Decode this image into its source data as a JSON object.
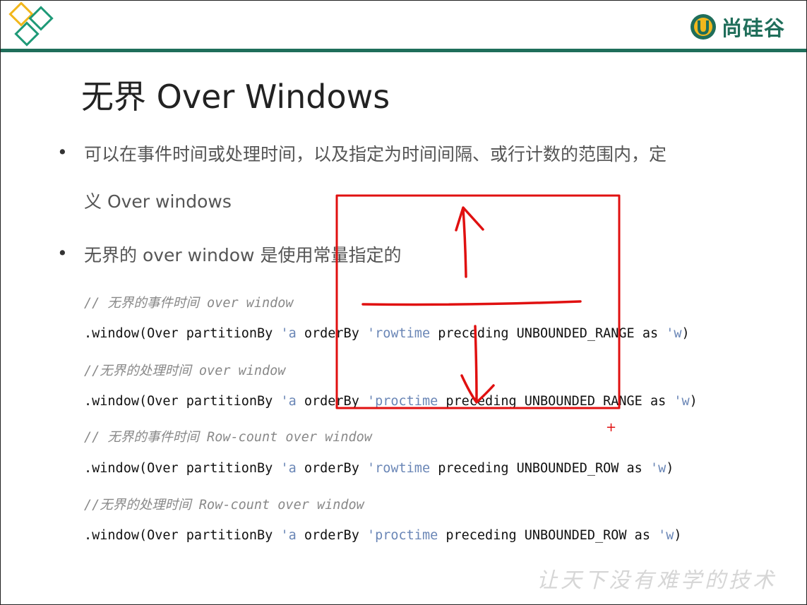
{
  "header": {
    "brand_name": "尚硅谷",
    "brand_letter": "U",
    "accent_color": "#1f6e5a",
    "corner_logo_colors": [
      "#f2b71c",
      "#1f9a78"
    ]
  },
  "title": "无界 Over Windows",
  "bullets": [
    {
      "line1": "可以在事件时间或处理时间，以及指定为时间间隔、或行计数的范围内，定",
      "line2": "义 Over windows"
    },
    {
      "line1": "无界的 over window 是使用常量指定的"
    }
  ],
  "code": [
    {
      "comment": "// 无界的事件时间 over window"
    },
    {
      "head": ".window(Over partitionBy ",
      "sym1": "'a",
      "mid1": " orderBy ",
      "sym2": "'rowtime",
      "mid2": " preceding UNBOUNDED_RANGE as ",
      "sym3": "'w",
      "tail": ")"
    },
    {
      "comment": "//无界的处理时间 over window"
    },
    {
      "head": ".window(Over partitionBy ",
      "sym1": "'a",
      "mid1": " orderBy ",
      "sym2": "'proctime",
      "mid2": " preceding UNBOUNDED_RANGE as ",
      "sym3": "'w",
      "tail": ")"
    },
    {
      "comment": "// 无界的事件时间 Row-count over window"
    },
    {
      "head": ".window(Over partitionBy ",
      "sym1": "'a",
      "mid1": " orderBy ",
      "sym2": "'rowtime",
      "mid2": " preceding UNBOUNDED_ROW as ",
      "sym3": "'w",
      "tail": ")"
    },
    {
      "comment": "//无界的处理时间 Row-count over window"
    },
    {
      "head": ".window(Over partitionBy ",
      "sym1": "'a",
      "mid1": " orderBy ",
      "sym2": "'proctime",
      "mid2": " preceding UNBOUNDED_ROW as ",
      "sym3": "'w",
      "tail": ")"
    }
  ],
  "annotation": {
    "color": "#e01010"
  },
  "watermark": "让天下没有难学的技术"
}
